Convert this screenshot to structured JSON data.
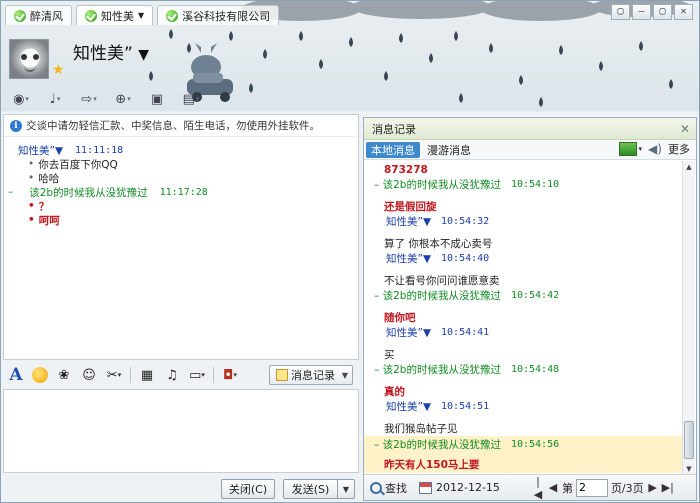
{
  "tabs": [
    {
      "label": "醉清风",
      "active": false
    },
    {
      "label": "知性美",
      "active": true
    },
    {
      "label": "溪谷科技有限公司",
      "active": false
    }
  ],
  "window_controls": [
    "▢",
    "–",
    "▢",
    "✕"
  ],
  "header": {
    "nickname": "知性美”"
  },
  "chat": {
    "notice": "交谈中请勿轻信汇款、中奖信息、陌生电话，勿使用外挂软件。",
    "messages": [
      {
        "sender": "知性美”▼",
        "time": "11:11:18",
        "lines": [
          "你去百度下你QQ",
          "哈哈"
        ],
        "self": false
      },
      {
        "sender": "该2b的时候我从没犹豫过",
        "time": "11:17:28",
        "lines": [
          "？",
          "呵呵"
        ],
        "self": true
      }
    ]
  },
  "editor": {
    "history_button": "消息记录",
    "close_button": "关闭(C)",
    "send_button": "发送(S)"
  },
  "history": {
    "title": "消息记录",
    "tab_local": "本地消息",
    "tab_roaming": "漫游消息",
    "more": "更多",
    "records": [
      {
        "text": "873278",
        "red": true
      },
      {
        "sender": "该2b的时候我从没犹豫过",
        "time": "10:54:10",
        "self": true
      },
      {
        "text": "还是假回旋",
        "red": true
      },
      {
        "sender": "知性美”▼",
        "time": "10:54:32",
        "self": false
      },
      {
        "text": "算了  你根本不成心卖号",
        "red": false
      },
      {
        "sender": "知性美”▼",
        "time": "10:54:40",
        "self": false
      },
      {
        "text": "不让看号你问问谁愿意卖",
        "red": false
      },
      {
        "sender": "该2b的时候我从没犹豫过",
        "time": "10:54:42",
        "self": true
      },
      {
        "text": "随你吧",
        "red": true
      },
      {
        "sender": "知性美”▼",
        "time": "10:54:41",
        "self": false
      },
      {
        "text": "买",
        "red": false
      },
      {
        "sender": "该2b的时候我从没犹豫过",
        "time": "10:54:48",
        "self": true
      },
      {
        "text": "真的",
        "red": true
      },
      {
        "sender": "知性美”▼",
        "time": "10:54:51",
        "self": false
      },
      {
        "text": "我们猴岛帖子见",
        "red": false
      },
      {
        "sender": "该2b的时候我从没犹豫过",
        "time": "10:54:56",
        "self": true,
        "highlight": true
      },
      {
        "text": "昨天有人150马上要",
        "red": true,
        "highlight": true
      }
    ],
    "footer": {
      "search": "查找",
      "date": "2012-12-15",
      "page_prefix": "第",
      "page_value": "2",
      "page_suffix": "页/3页"
    }
  }
}
